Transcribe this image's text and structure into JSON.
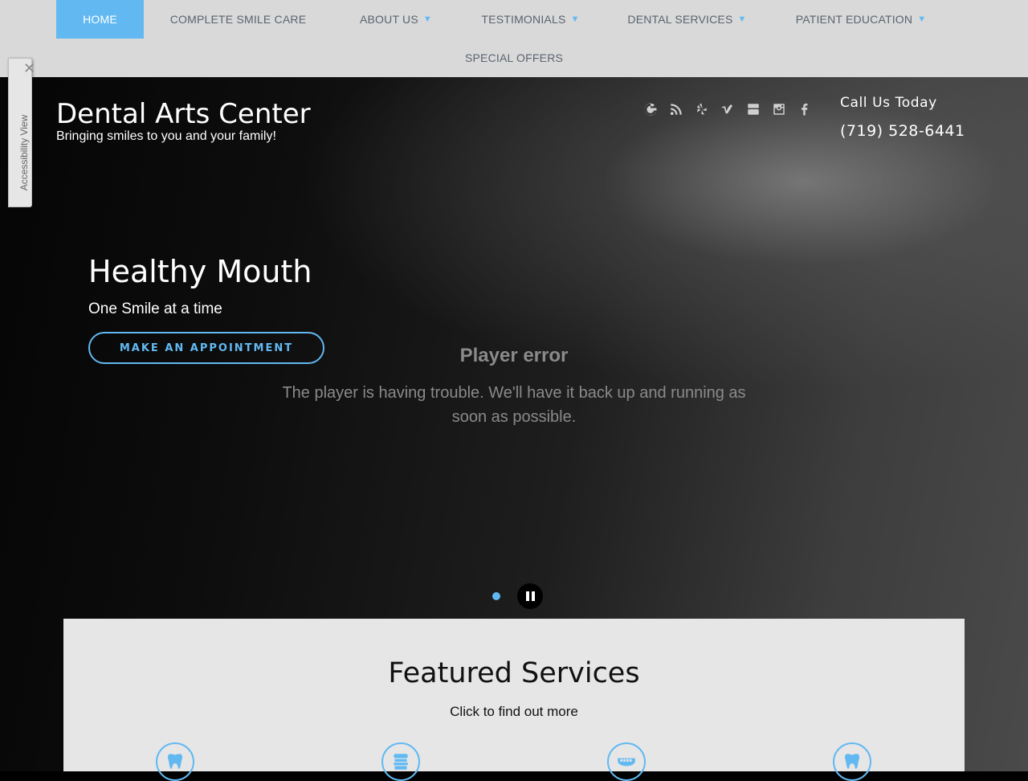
{
  "nav": {
    "items": [
      {
        "label": "HOME",
        "active": true,
        "dropdown": false
      },
      {
        "label": "COMPLETE SMILE CARE",
        "active": false,
        "dropdown": false
      },
      {
        "label": "ABOUT US",
        "active": false,
        "dropdown": true
      },
      {
        "label": "TESTIMONIALS",
        "active": false,
        "dropdown": true
      },
      {
        "label": "DENTAL SERVICES",
        "active": false,
        "dropdown": true
      },
      {
        "label": "PATIENT EDUCATION",
        "active": false,
        "dropdown": true
      }
    ],
    "row2": {
      "label": "SPECIAL OFFERS"
    },
    "caret": "▼"
  },
  "header": {
    "title": "Dental Arts Center",
    "tagline": "Bringing smiles to you and your family!",
    "call_label": "Call Us Today",
    "phone": "(719) 528-6441"
  },
  "social": [
    "google-icon",
    "rss-icon",
    "yelp-icon",
    "vimeo-icon",
    "youtube-icon",
    "instagram-icon",
    "facebook-icon"
  ],
  "slide": {
    "title": "Healthy Mouth",
    "subtitle": "One Smile at a time",
    "button": "MAKE AN APPOINTMENT"
  },
  "player": {
    "error_title": "Player error",
    "error_message": "The player is having trouble. We'll have it back up and running as soon as possible."
  },
  "accessibility": {
    "label": "Accessibility View",
    "close": "✕"
  },
  "featured": {
    "title": "Featured Services",
    "subtitle": "Click to find out more",
    "icons": [
      "tooth-icon",
      "toothbrush-icon",
      "dentures-icon",
      "tooth-icon"
    ]
  },
  "colors": {
    "accent": "#62b9f2",
    "nav_bg": "#d9d9d9",
    "featured_bg": "#e6e6e6"
  }
}
